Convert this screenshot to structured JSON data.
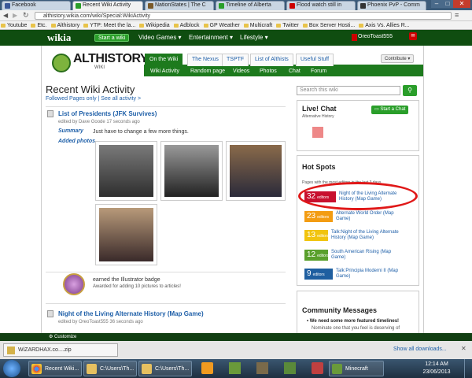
{
  "tabs": [
    {
      "label": "Facebook",
      "color": "#3b5998"
    },
    {
      "label": "Recent Wiki Activity",
      "color": "#2a9e2a"
    },
    {
      "label": "NationStates | The C",
      "color": "#7a5a2a"
    },
    {
      "label": "Timeline of Alberta",
      "color": "#2a9e2a"
    },
    {
      "label": "Flood watch still in",
      "color": "#c00"
    },
    {
      "label": "Phoenix PvP - Comm",
      "color": "#333"
    }
  ],
  "address": {
    "url": "althistory.wikia.com/wiki/Special:WikiActivity"
  },
  "bookmarks": [
    "Youtube",
    "Etc.",
    "Althistory",
    "YTP: Meet the la...",
    "Wikipedia",
    "Adblock",
    "GP Weather",
    "Multicraft",
    "Twitter",
    "Box Server Hosti...",
    "Axis Vs. Allies R..."
  ],
  "wikia": {
    "logo": "wikia",
    "start_wiki": "Start a wiki",
    "nav": [
      "Video Games",
      "Entertainment",
      "Lifestyle"
    ],
    "user": "OreoToast555"
  },
  "site": {
    "name": "ALTHISTORY",
    "sub": "WIKI",
    "tabs": [
      "On the Wiki",
      "The Nexus",
      "TSPTF",
      "List of Althists",
      "Useful Stuff"
    ],
    "subnav": [
      "Wiki Activity",
      "Random page",
      "Videos",
      "Photos",
      "Chat",
      "Forum"
    ],
    "contribute": "Contribute"
  },
  "page": {
    "title": "Recent Wiki Activity",
    "follow": "Followed Pages only  |  See all activity >"
  },
  "activity": [
    {
      "title": "List of Presidents (JFK Survives)",
      "meta": "edited by Dave Goode 17 seconds ago",
      "summary_label": "Summary",
      "summary": "Just have to change a few more things.",
      "photos_label": "Added photos"
    },
    {
      "badge_text": "earned the Illustrator badge",
      "badge_sub": "Awarded for adding 10 pictures to articles!"
    },
    {
      "title": "Night of the Living Alternate History (Map Game)",
      "meta": "edited by OreoToast555 36 seconds ago"
    }
  ],
  "rail": {
    "search_placeholder": "Search this wiki",
    "chat_title": "Live! Chat",
    "chat_sub": "Alternative History",
    "chat_btn": "Start a Chat",
    "hot_title": "Hot Spots",
    "hot_sub": "Pages with the most editors in the last 3 days",
    "hot": [
      {
        "n": "32",
        "label": "Night of the Living Alternate History (Map Game)",
        "color": "#c8102e"
      },
      {
        "n": "23",
        "label": "Alternate World Order (Map Game)",
        "color": "#f39c12"
      },
      {
        "n": "13",
        "label": "Talk:Night of the Living Alternate History (Map Game)",
        "color": "#f1c40f"
      },
      {
        "n": "12",
        "label": "South American Rising (Map Game)",
        "color": "#5aa02c"
      },
      {
        "n": "9",
        "label": "Talk:Principia Moderni II (Map Game)",
        "color": "#1f5fa0"
      }
    ],
    "hot_editors": "editors",
    "community_title": "Community Messages",
    "community_1": "We need some more featured timelines!",
    "community_2": "Nominate one that you feel is deserving of"
  },
  "bottom": {
    "customize": "Customize",
    "download": "WiZARDHAX.co....zip",
    "show_all": "Show all downloads..."
  },
  "taskbar": {
    "items": [
      "Recent Wiki...",
      "C:\\Users\\Th...",
      "C:\\Users\\Th...",
      "Minecraft"
    ],
    "time": "12:14 AM",
    "date": "23/06/2013"
  }
}
